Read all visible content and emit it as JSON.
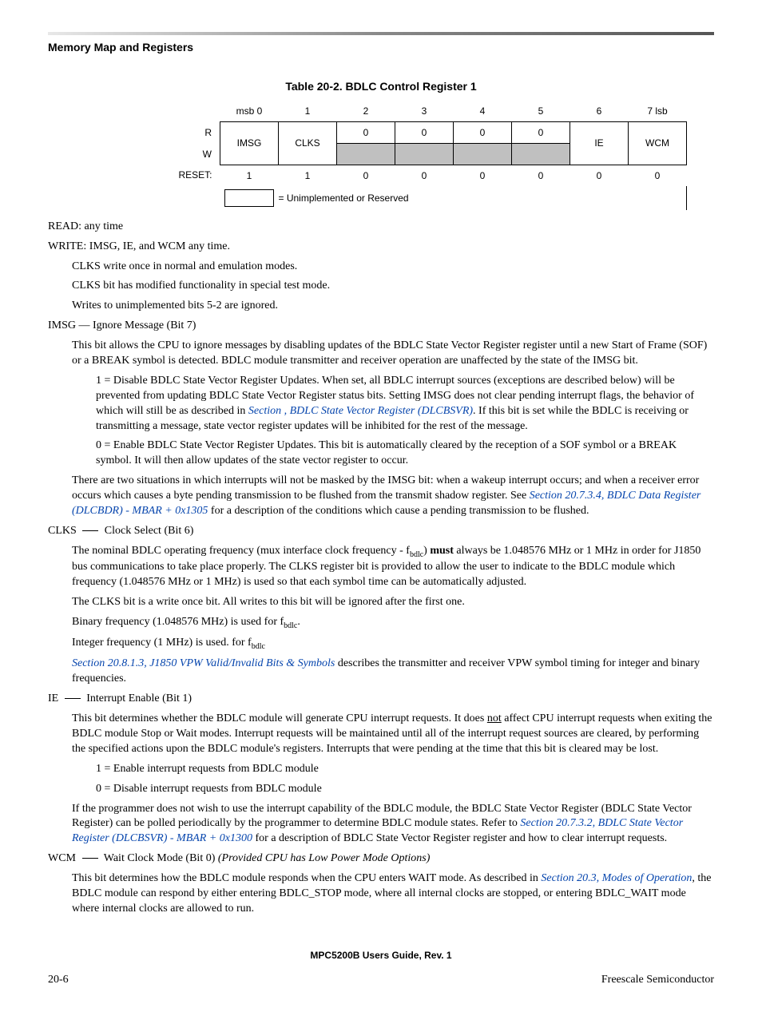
{
  "header": {
    "section": "Memory Map and Registers"
  },
  "table": {
    "title": "Table 20-2. BDLC Control Register 1",
    "bits": [
      "msb 0",
      "1",
      "2",
      "3",
      "4",
      "5",
      "6",
      "7 lsb"
    ],
    "r_label": "R",
    "w_label": "W",
    "reset_label": "RESET:",
    "r": [
      "IMSG",
      "CLKS",
      "0",
      "0",
      "0",
      "0",
      "IE",
      "WCM"
    ],
    "reset": [
      "1",
      "1",
      "0",
      "0",
      "0",
      "0",
      "0",
      "0"
    ],
    "legend": "= Unimplemented or Reserved"
  },
  "body": {
    "read": "READ: any time",
    "write": "WRITE: IMSG, IE, and WCM any time.",
    "clks_note1": "CLKS write once in normal and emulation modes.",
    "clks_note2": "CLKS bit has modified functionality in special test mode.",
    "writes_note": "Writes to unimplemented bits 5-2 are ignored.",
    "imsg_head": "IMSG — Ignore Message (Bit 7)",
    "imsg_p1": "This bit allows the CPU to ignore messages by disabling updates of the BDLC State Vector Register register until a new Start of Frame (SOF) or a BREAK symbol is detected. BDLC module transmitter and receiver operation are unaffected by the state of the IMSG bit.",
    "imsg_1a": "1 = Disable BDLC State Vector Register Updates. When set, all BDLC interrupt sources (exceptions are described below) will be prevented from updating BDLC State Vector Register status bits. Setting IMSG does not clear pending interrupt flags, the behavior of which will still be as described in ",
    "imsg_1link": "Section , BDLC State Vector Register (DLCBSVR)",
    "imsg_1b": ". If this bit is set while the BDLC is receiving or transmitting a message, state vector register updates will be inhibited for the rest of the message.",
    "imsg_0": "0 = Enable BDLC State Vector Register Updates. This bit is automatically cleared by the reception of a SOF symbol or a BREAK symbol. It will then allow updates of the state vector register to occur.",
    "imsg_p2a": "There are two situations in which interrupts will not be masked by the IMSG bit: when a wakeup interrupt occurs; and when a receiver error occurs which causes a byte pending transmission to be flushed from the transmit shadow register. See ",
    "imsg_p2link": "Section 20.7.3.4, BDLC Data Register (DLCBDR) - MBAR + 0x1305",
    "imsg_p2b": " for a description of the conditions which cause a pending transmission to be flushed.",
    "clks_head_pre": "CLKS ",
    "clks_head_post": " Clock Select (Bit 6)",
    "clks_p1a": "The nominal BDLC operating frequency (mux interface clock frequency - f",
    "clks_p1b": ") ",
    "clks_must": "must",
    "clks_p1c": " always be 1.048576 MHz or 1 MHz in order for J1850 bus communications to take place properly. The CLKS register bit is provided to allow the user to indicate to the BDLC module which frequency (1.048576 MHz or 1 MHz) is used so that each symbol time can be automatically adjusted.",
    "clks_p2": "The CLKS bit is a write once bit. All writes to this bit will be ignored after the first one.",
    "clks_p3a": "Binary frequency (1.048576 MHz) is used for f",
    "clks_p3b": ".",
    "clks_p4a": "Integer frequency (1 MHz) is used. for f",
    "clks_p5link": "Section 20.8.1.3, J1850 VPW Valid/Invalid Bits & Symbols",
    "clks_p5b": " describes the transmitter and receiver VPW symbol timing for integer and binary frequencies.",
    "ie_head_pre": "IE ",
    "ie_head_post": " Interrupt Enable (Bit 1)",
    "ie_p1a": "This bit determines whether the BDLC module will generate CPU interrupt requests. It does ",
    "ie_not": "not",
    "ie_p1b": " affect CPU interrupt requests when exiting the BDLC module Stop or Wait modes. Interrupt requests will be maintained until all of the interrupt request sources are cleared, by performing the specified actions upon the BDLC module's registers. Interrupts that were pending at the time that this bit is cleared may be lost.",
    "ie_1": "1 = Enable interrupt requests from BDLC module",
    "ie_0": "0 = Disable interrupt requests from BDLC module",
    "ie_p2a": "If the programmer does not wish to use the interrupt capability of the BDLC module, the BDLC State Vector Register (BDLC State Vector Register) can be polled periodically by the programmer to determine BDLC module states. Refer to ",
    "ie_p2link": "Section 20.7.3.2, BDLC State Vector Register (DLCBSVR) - MBAR + 0x1300",
    "ie_p2b": " for a description of BDLC State Vector Register register and how to clear interrupt requests.",
    "wcm_head_pre": "WCM ",
    "wcm_head_post": " Wait Clock Mode (Bit 0) ",
    "wcm_head_ital": "(Provided CPU has Low Power Mode Options)",
    "wcm_p1a": "This bit determines how the BDLC module responds when the CPU enters WAIT mode. As described in ",
    "wcm_p1link": "Section 20.3, Modes of Operation",
    "wcm_p1b": ", the BDLC module can respond by either entering BDLC_STOP mode, where all internal clocks are stopped, or entering BDLC_WAIT mode where internal clocks are allowed to run.",
    "sub": "bdlc"
  },
  "footer": {
    "center": "MPC5200B Users Guide, Rev. 1",
    "left": "20-6",
    "right": "Freescale Semiconductor"
  }
}
